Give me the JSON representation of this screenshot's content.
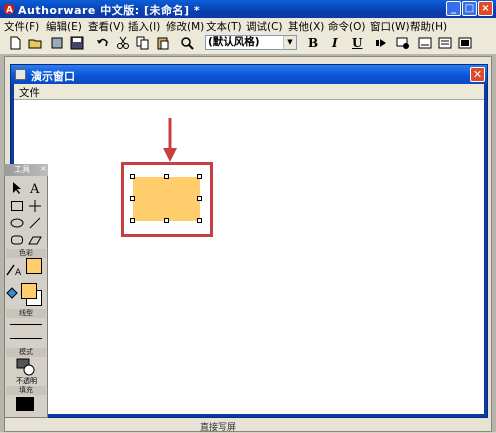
{
  "app": {
    "title": "Authorware 中文版: [未命名] *",
    "window_controls": [
      "_",
      "□",
      "×"
    ]
  },
  "menubar": {
    "items": [
      "文件(F)",
      "编辑(E)",
      "查看(V)",
      "插入(I)",
      "修改(M)",
      "文本(T)",
      "调试(C)",
      "其他(X)",
      "命令(O)",
      "窗口(W)",
      "帮助(H)"
    ]
  },
  "toolbar": {
    "style_select": "(默认风格)",
    "bold": "B",
    "italic": "I",
    "underline": "U"
  },
  "presentation_window": {
    "title": "演示窗口",
    "menu": "文件"
  },
  "toolbox": {
    "title": "工具",
    "sections": {
      "color": "色彩",
      "line": "线型",
      "mode": "模式",
      "mode_value": "不透明",
      "fill": "填充"
    },
    "fill_color": "#ffcd6b"
  },
  "status": {
    "text": "直接写屏"
  },
  "colors": {
    "highlight_red": "#c64040",
    "shape_fill": "#ffcd6b"
  }
}
